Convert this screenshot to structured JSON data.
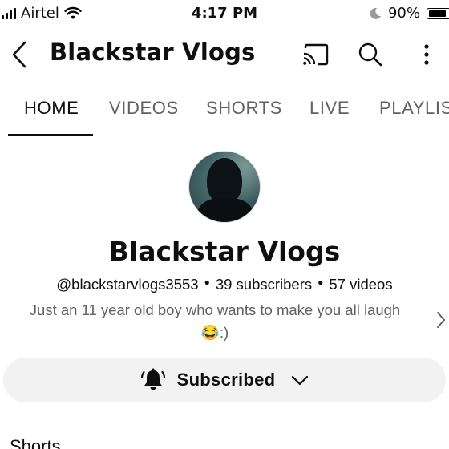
{
  "status_bar": {
    "carrier": "Airtel",
    "time": "4:17 PM",
    "battery": "90%",
    "battery_level": 0.9,
    "icons": [
      "signal-icon",
      "wifi-icon",
      "moon-icon",
      "battery-icon"
    ]
  },
  "header": {
    "title": "Blackstar Vlogs",
    "icons": [
      "back-arrow-icon",
      "cast-icon",
      "search-icon",
      "more-vert-icon"
    ]
  },
  "tabs": [
    {
      "label": "HOME",
      "active": true
    },
    {
      "label": "VIDEOS",
      "active": false
    },
    {
      "label": "SHORTS",
      "active": false
    },
    {
      "label": "LIVE",
      "active": false
    },
    {
      "label": "PLAYLIS",
      "active": false
    }
  ],
  "channel": {
    "name": "Blackstar Vlogs",
    "handle": "@blackstarvlogs3553",
    "subscribers": "39 subscribers",
    "videos": "57 videos",
    "description_line1": "Just an 11 year old boy who wants to make you all laugh",
    "description_line2": "😂:)"
  },
  "subscribe_button": {
    "label": "Subscribed",
    "icons": [
      "bell-icon",
      "chevron-down-icon"
    ]
  },
  "sections": {
    "shorts_title": "Shorts"
  },
  "colors": {
    "text_primary": "#0f0f0f",
    "text_secondary": "#606060",
    "button_bg": "#f2f2f2"
  }
}
